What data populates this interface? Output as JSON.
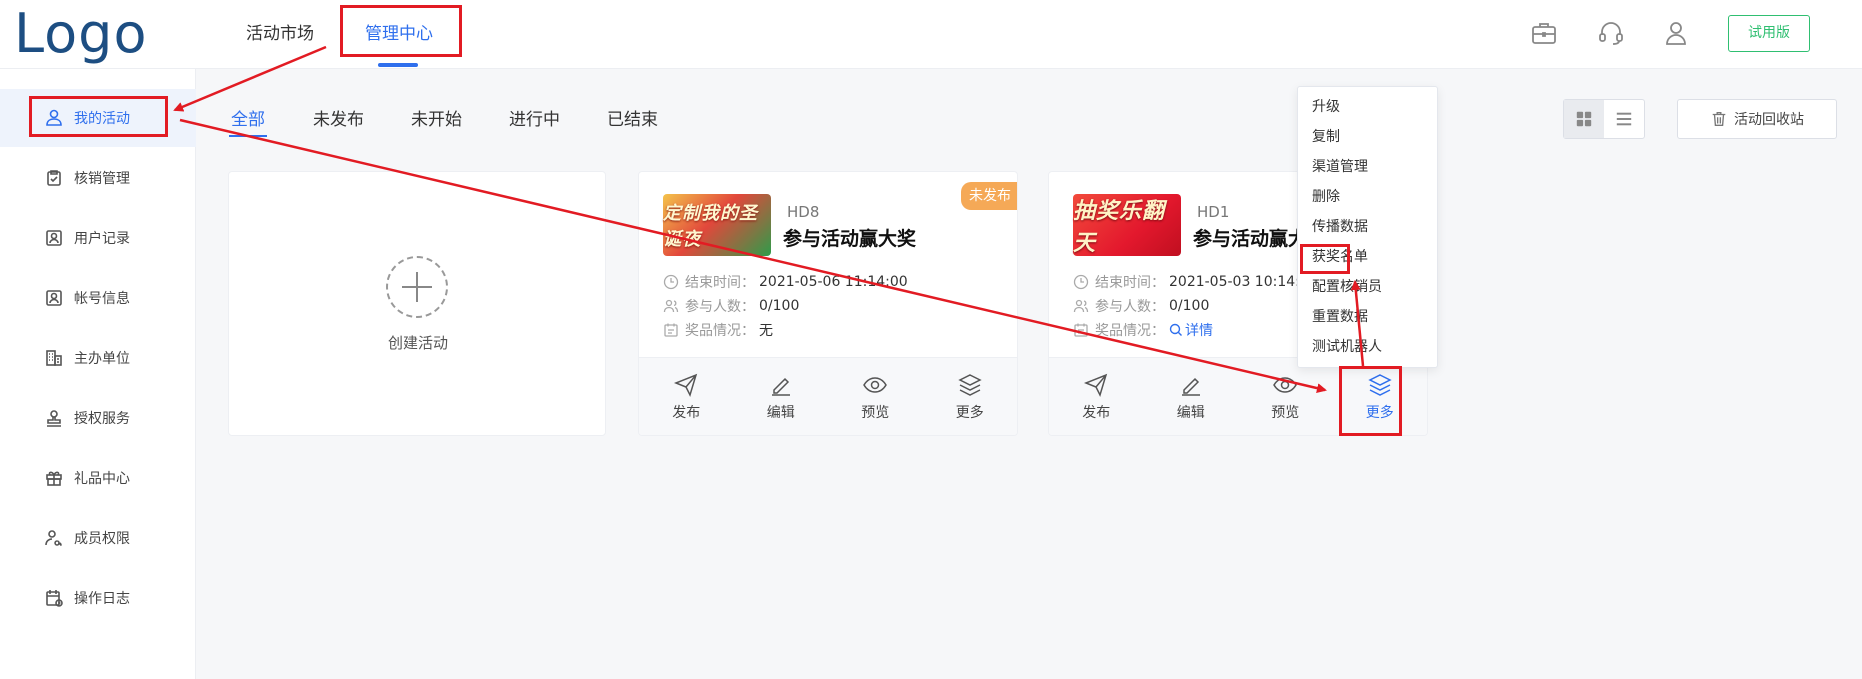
{
  "header": {
    "logo": "Logo",
    "nav": [
      "活动市场",
      "管理中心"
    ],
    "trial_label": "试用版",
    "icons": [
      "briefcase-icon",
      "headset-icon",
      "user-icon"
    ]
  },
  "sidebar": {
    "items": [
      {
        "label": "我的活动",
        "icon": "user-icon",
        "active": true
      },
      {
        "label": "核销管理",
        "icon": "clipboard-check-icon"
      },
      {
        "label": "用户记录",
        "icon": "user-record-icon"
      },
      {
        "label": "帐号信息",
        "icon": "account-icon"
      },
      {
        "label": "主办单位",
        "icon": "building-icon"
      },
      {
        "label": "授权服务",
        "icon": "stamp-icon"
      },
      {
        "label": "礼品中心",
        "icon": "gift-icon"
      },
      {
        "label": "成员权限",
        "icon": "member-key-icon"
      },
      {
        "label": "操作日志",
        "icon": "calendar-log-icon"
      }
    ]
  },
  "tabs": [
    "全部",
    "未发布",
    "未开始",
    "进行中",
    "已结束"
  ],
  "toolbar": {
    "recycle_label": "活动回收站"
  },
  "create_card": {
    "label": "创建活动"
  },
  "cards": [
    {
      "thumb_text": "定制我的圣诞夜",
      "code": "HD8",
      "title": "参与活动赢大奖",
      "badge": "未发布",
      "end_label": "结束时间：",
      "end_value": "2021-05-06 11:14:00",
      "people_label": "参与人数：",
      "people_value": "0/100",
      "prize_label": "奖品情况：",
      "prize_value": "无",
      "actions": [
        "发布",
        "编辑",
        "预览",
        "更多"
      ]
    },
    {
      "thumb_text": "抽奖乐翻天",
      "code": "HD1",
      "title": "参与活动赢大",
      "end_label": "结束时间：",
      "end_value": "2021-05-03 10:14:0",
      "people_label": "参与人数：",
      "people_value": "0/100",
      "prize_label": "奖品情况：",
      "prize_link": "详情",
      "actions": [
        "发布",
        "编辑",
        "预览",
        "更多"
      ]
    }
  ],
  "dropdown": {
    "items": [
      "升级",
      "复制",
      "渠道管理",
      "删除",
      "传播数据",
      "获奖名单",
      "配置核销员",
      "重置数据",
      "测试机器人"
    ]
  },
  "colors": {
    "accent": "#2f6fed",
    "annotation": "#e21b23",
    "trial": "#2fbf71",
    "badge": "#f5a957"
  }
}
